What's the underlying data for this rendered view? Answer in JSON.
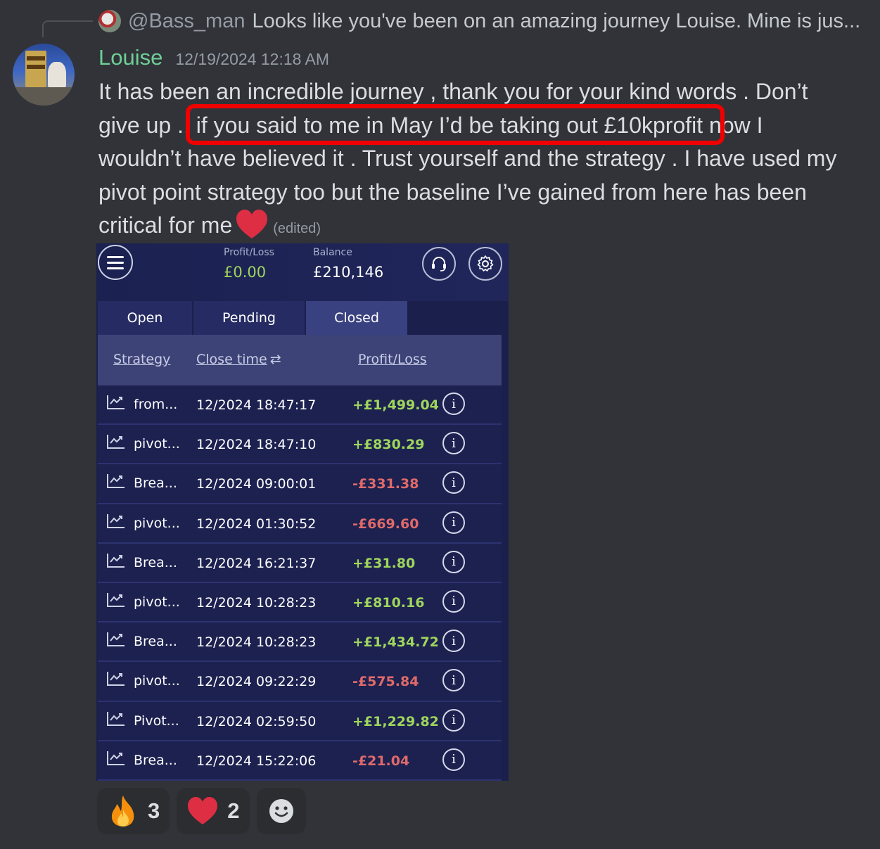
{
  "reply": {
    "username": "@Bass_man",
    "preview": "Looks like you've been on an amazing journey Louise. Mine is jus..."
  },
  "message": {
    "username": "Louise",
    "timestamp": "12/19/2024 12:18 AM",
    "text_part1": "It has been an incredible journey , thank you for your kind words . Don’t give up .. ",
    "text_highlighted": "if you said to me in May I’d be taking out £10kprofit",
    "text_part2": " now I wouldn’t have believed it . Trust yourself and the strategy . I have used my pivot point strategy  too  but the baseline I’ve gained from here has been critical  for me",
    "edited_label": "(edited)",
    "highlight_color": "#f00000"
  },
  "app": {
    "profit_loss_label": "Profit/Loss",
    "profit_loss_value": "£0.00",
    "balance_label": "Balance",
    "balance_value": "£210,146",
    "tabs": [
      {
        "label": "Open",
        "active": false
      },
      {
        "label": "Pending",
        "active": false
      },
      {
        "label": "Closed",
        "active": true
      }
    ],
    "columns": {
      "strategy": "Strategy",
      "close_time": "Close time",
      "profit_loss": "Profit/Loss"
    },
    "rows": [
      {
        "strategy": "from...",
        "close_time": "12/2024 18:47:17",
        "pl": "+£1,499.04",
        "positive": true
      },
      {
        "strategy": "pivot...",
        "close_time": "12/2024 18:47:10",
        "pl": "+£830.29",
        "positive": true
      },
      {
        "strategy": "Brea...",
        "close_time": "12/2024 09:00:01",
        "pl": "-£331.38",
        "positive": false
      },
      {
        "strategy": "pivot...",
        "close_time": "12/2024 01:30:52",
        "pl": "-£669.60",
        "positive": false
      },
      {
        "strategy": "Brea...",
        "close_time": "12/2024 16:21:37",
        "pl": "+£31.80",
        "positive": true
      },
      {
        "strategy": "pivot...",
        "close_time": "12/2024 10:28:23",
        "pl": "+£810.16",
        "positive": true
      },
      {
        "strategy": "Brea...",
        "close_time": "12/2024 10:28:23",
        "pl": "+£1,434.72",
        "positive": true
      },
      {
        "strategy": "pivot...",
        "close_time": "12/2024 09:22:29",
        "pl": "-£575.84",
        "positive": false
      },
      {
        "strategy": "Pivot...",
        "close_time": "12/2024 02:59:50",
        "pl": "+£1,229.82",
        "positive": true
      },
      {
        "strategy": "Brea...",
        "close_time": "12/2024 15:22:06",
        "pl": "-£21.04",
        "positive": false
      }
    ]
  },
  "reactions": [
    {
      "icon": "fire-icon",
      "count": "3"
    },
    {
      "icon": "heart-icon",
      "count": "2"
    }
  ],
  "colors": {
    "positive": "#9fd65c",
    "negative": "#e06a6a",
    "username": "#6fcf97"
  }
}
